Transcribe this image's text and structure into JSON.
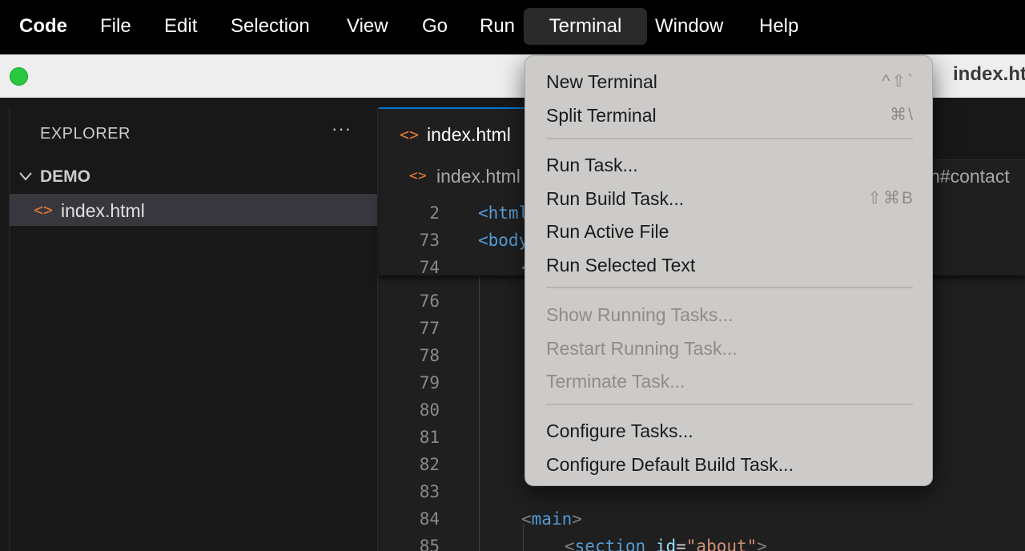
{
  "menubar": {
    "items": [
      {
        "label": "Code",
        "app": true
      },
      {
        "label": "File"
      },
      {
        "label": "Edit"
      },
      {
        "label": "Selection"
      },
      {
        "label": "View"
      },
      {
        "label": "Go"
      },
      {
        "label": "Run"
      },
      {
        "label": "Terminal",
        "active": true
      },
      {
        "label": "Window"
      },
      {
        "label": "Help"
      }
    ]
  },
  "window": {
    "title": "index.ht"
  },
  "sidebar": {
    "title": "EXPLORER",
    "more": "···",
    "folder": "DEMO",
    "file": "index.html"
  },
  "editor": {
    "tab_label": "index.html",
    "breadcrumb": {
      "file": "index.html",
      "tail": "n#contact"
    },
    "sticky_lines": [
      {
        "num": "2",
        "text": "<html"
      },
      {
        "num": "73",
        "text": "<body"
      },
      {
        "num": "74",
        "text": "<"
      }
    ],
    "lines": [
      {
        "num": "76"
      },
      {
        "num": "77"
      },
      {
        "num": "78"
      },
      {
        "num": "79"
      },
      {
        "num": "80"
      },
      {
        "num": "81"
      },
      {
        "num": "82"
      },
      {
        "num": "83"
      },
      {
        "num": "84",
        "tag": "main"
      },
      {
        "num": "85",
        "tag": "section",
        "attr": "id",
        "value": "\"about\""
      }
    ]
  },
  "terminal_menu": {
    "items": [
      {
        "label": "New Terminal",
        "shortcut": "^⇧`",
        "enabled": true
      },
      {
        "label": "Split Terminal",
        "shortcut": "⌘\\",
        "enabled": true
      },
      {
        "separator": true
      },
      {
        "label": "Run Task...",
        "enabled": true
      },
      {
        "label": "Run Build Task...",
        "shortcut": "⇧⌘B",
        "enabled": true
      },
      {
        "label": "Run Active File",
        "enabled": true
      },
      {
        "label": "Run Selected Text",
        "enabled": true
      },
      {
        "separator": true
      },
      {
        "label": "Show Running Tasks...",
        "enabled": false
      },
      {
        "label": "Restart Running Task...",
        "enabled": false
      },
      {
        "label": "Terminate Task...",
        "enabled": false
      },
      {
        "separator": true
      },
      {
        "label": "Configure Tasks...",
        "enabled": true
      },
      {
        "label": "Configure Default Build Task...",
        "enabled": true
      }
    ]
  },
  "colors": {
    "accent": "#0078d4",
    "file_icon": "#e37933",
    "traffic_green": "#28c940"
  }
}
